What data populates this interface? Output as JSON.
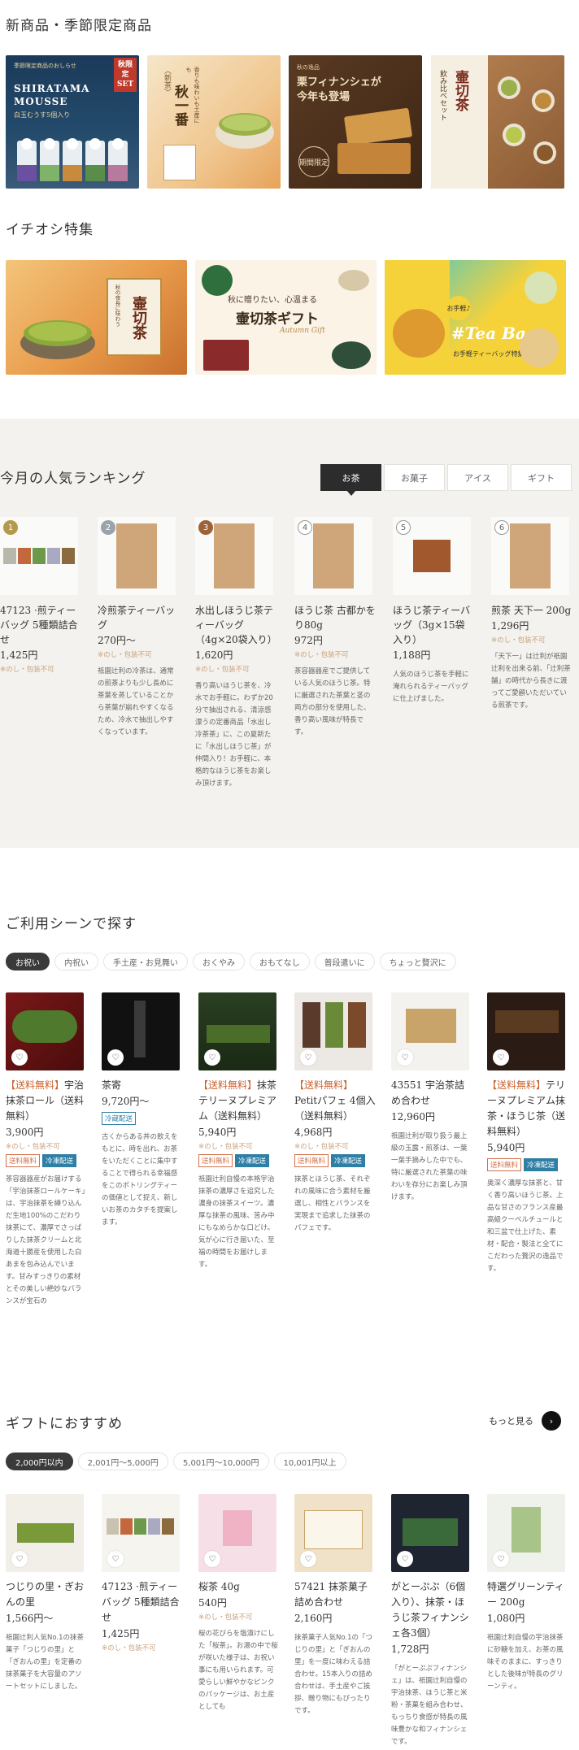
{
  "sections": {
    "new_items_title": "新商品・季節限定商品",
    "featured_title": "イチオシ特集",
    "ranking_title": "今月の人気ランキング",
    "scene_title": "ご利用シーンで探す",
    "gift_title": "ギフトにおすすめ"
  },
  "new_items": [
    {
      "badge": "秋限定SET",
      "line1": "SHIRATAMA",
      "line2": "MOUSSE",
      "line3": "白玉むうす5個入り",
      "top": "季節限定商品のおしらせ"
    },
    {
      "line1": "秋一番",
      "line2": "香りも味わいも土産にも",
      "line3": "〈新茶〉"
    },
    {
      "line1": "栗フィナンシェが",
      "line2": "今年も登場",
      "line3": "期間限定",
      "top": "秋の逸品"
    },
    {
      "line1": "壷切茶",
      "line2": "飲み比べセット"
    }
  ],
  "featured": [
    {
      "line1": "壷切茶",
      "line2": "秋の夜長に味わう"
    },
    {
      "line1": "秋に贈りたい、心温まる",
      "line2": "壷切茶ギフト",
      "line3": "Autumn Gift"
    },
    {
      "line1": "お手軽♪",
      "line2": "#Tea Bag",
      "line3": "お手軽ティーバッグ特集"
    }
  ],
  "ranking_tabs": [
    "お茶",
    "お菓子",
    "アイス",
    "ギフト"
  ],
  "ranking": [
    {
      "rank": "1",
      "name": "47123 ·煎ティーバッグ 5種類詰合せ",
      "price": "1,425円",
      "note": "※のし・包装不可",
      "desc": "",
      "badge_color": "#b39a4c"
    },
    {
      "rank": "2",
      "name": "冷煎茶ティーバッグ",
      "price": "270円〜",
      "note": "※のし・包装不可",
      "desc": "祇園辻利の冷茶は、通常の煎茶よりも少し長めに茶葉を蒸していることから茶葉が崩れやすくなるため、冷水で抽出しやすくなっています。",
      "badge_color": "#9aa3ab"
    },
    {
      "rank": "3",
      "name": "水出しほうじ茶ティーバッグ（4g×20袋入り）",
      "price": "1,620円",
      "note": "※のし・包装不可",
      "desc": "香り高いほうじ茶を、冷水でお手軽に。わずか20分で抽出される、清涼感漂うの定番商品「水出し冷茶茶」に、この夏新たに「水出しほうじ茶」が仲間入り！お手軽に、本格的なほうじ茶をお楽しみ頂けます。",
      "badge_color": "#9c6238"
    },
    {
      "rank": "4",
      "name": "ほうじ茶 古都かをり80g",
      "price": "972円",
      "note": "※のし・包装不可",
      "desc": "茶容器器産でご提供している人気のほうじ茶。特に厳選された茶葉と茎の両方の部分を使用した、香り高い風味が特長です。",
      "badge_color": "#ffffff"
    },
    {
      "rank": "5",
      "name": "ほうじ茶ティーバッグ（3g×15袋入り）",
      "price": "1,188円",
      "note": "",
      "desc": "人気のほうじ茶を手軽に淹れられるティーバッグに仕上げました。",
      "badge_color": "#ffffff"
    },
    {
      "rank": "6",
      "name": "煎茶 天下一 200g",
      "price": "1,296円",
      "note": "※のし・包装不可",
      "desc": "「天下一」は辻利が祇園辻利を出来る前、「辻利茶舗」の時代から長きに渡ってご愛顧いただいている煎茶です。",
      "badge_color": "#ffffff"
    }
  ],
  "scene_tabs": [
    "お祝い",
    "内祝い",
    "手土産・お見舞い",
    "おくやみ",
    "おもてなし",
    "普段遣いに",
    "ちょっと贅沢に"
  ],
  "scene_products": [
    {
      "hl": "【送料無料】",
      "name": "宇治抹茶ロール（送料無料）",
      "price": "3,900円",
      "note": "※のし・包装不可",
      "tags": [
        "送料無料",
        "冷凍配送"
      ],
      "desc": "茶容器器産がお届けする「宇治抹茶ロールケーキ」は、宇治抹茶を練り込んだ生地100%のこだわり抹茶にて、濃厚でさっぱりした抹茶クリームと北海道十勝産を使用した白あまを包み込んでいます。甘みすっきりの素材とその美しい絶妙なバランスが宝石の"
    },
    {
      "hl": "",
      "name": "茶寄",
      "price": "9,720円〜",
      "note": "",
      "tags": [
        "冷蔵配送"
      ],
      "desc": "古くからある丼の飲えをもとに、時を出れ、お茶をいただくことに集中することで得られる幸福感をこのポトリングティーの価値として捉え、新しいお茶のカタチを提案します。"
    },
    {
      "hl": "【送料無料】",
      "name": "抹茶テリーヌプレミアム（送料無料）",
      "price": "5,940円",
      "note": "※のし・包装不可",
      "tags": [
        "送料無料",
        "冷凍配送"
      ],
      "desc": "祇園辻利自慢の本格宇治抹茶の濃厚さを追究した濃身の抹茶スイーツ。濃厚な抹茶の風味、苦み中にもなめらかな口どけ。気が心に行き届いた、至福の時間をお届けします。"
    },
    {
      "hl": "【送料無料】",
      "name": "Petitパフェ 4個入（送料無料）",
      "price": "4,968円",
      "note": "※のし・包装不可",
      "tags": [
        "送料無料",
        "冷凍配送"
      ],
      "desc": "抹茶とほうじ茶、それぞれの風味に合う素材を厳選し、相性とバランスを実現まで追求した抹茶のパフェです。"
    },
    {
      "hl": "",
      "name": "43551 宇治茶詰め合わせ",
      "price": "12,960円",
      "note": "",
      "tags": [],
      "desc": "祇園辻利が取り扱う最上級の玉露・煎茶は、一葉一葉手摘みした中でも、特に厳選された茶葉の味わいを存分にお楽しみ頂けます。"
    },
    {
      "hl": "【送料無料】",
      "name": "テリーヌプレミアム抹茶・ほうじ茶（送料無料）",
      "price": "5,940円",
      "note": "",
      "tags": [
        "送料無料",
        "冷凍配送"
      ],
      "desc": "奥深く濃厚な抹茶と、甘く香り高いほうじ茶。上品な甘さのフランス産最高級クーベルチュールと和三盆で仕上げた、素材・配合・製法と全てにこだわった贅沢の逸品です。"
    }
  ],
  "gift_more": "もっと見る",
  "price_tabs": [
    "2,000円以内",
    "2,001円〜5,000円",
    "5,001円〜10,000円",
    "10,001円以上"
  ],
  "gift_products": [
    {
      "name": "つじりの里・ぎおんの里",
      "price": "1,566円〜",
      "note": "",
      "desc": "祇園辻利人気No.1の抹茶菓子「つじりの里」と「ぎおんの里」を定番の抹茶菓子を大容量のアソートセットにしました。"
    },
    {
      "name": "47123 ·煎ティーバッグ 5種類詰合せ",
      "price": "1,425円",
      "note": "※のし・包装不可",
      "desc": ""
    },
    {
      "name": "桜茶 40g",
      "price": "540円",
      "note": "※のし・包装不可",
      "desc": "桜の花びらを塩漬けにした「桜茶」。お湯の中で桜が咲いた様子は、お祝い事にも用いられます。可愛らしい鮮やかなピンクのパッケージは、お土産としても"
    },
    {
      "name": "57421 抹茶菓子詰め合わせ",
      "price": "2,160円",
      "note": "",
      "desc": "抹茶菓子人気No.1の「つじりの里」と「ぎおんの里」を一度に味わえる詰合わせ。15本入りの詰め合わせは、手土産やご挨拶、贈り物にもぴったりです。"
    },
    {
      "name": "がとーぷぷ（6個入り）、抹茶・ほうじ茶フィナンシェ各3個）",
      "price": "1,728円",
      "note": "",
      "desc": "「がとーぷぷフィナンシェ」は、祇園辻利自慢の宇治抹茶、ほうじ茶と米粉・茶菓を組み合わせ、もっちり食感が特長の風味豊かな和フィナンシェです。"
    },
    {
      "name": "特選グリーンティー 200g",
      "price": "1,080円",
      "note": "",
      "desc": "祇園辻利自慢の宇治抹茶に砂糖を加え、お茶の風味そのままに、すっきりとした後味が特長のグリーンティ。"
    }
  ],
  "icons": {
    "heart": "heart-icon",
    "arrow": "arrow-right-icon"
  },
  "colors": {
    "accent_orange": "#c9612f",
    "cool_blue": "#2f7fa5",
    "tab_dark": "#2c2c2c",
    "band": "#f3f2ee"
  }
}
